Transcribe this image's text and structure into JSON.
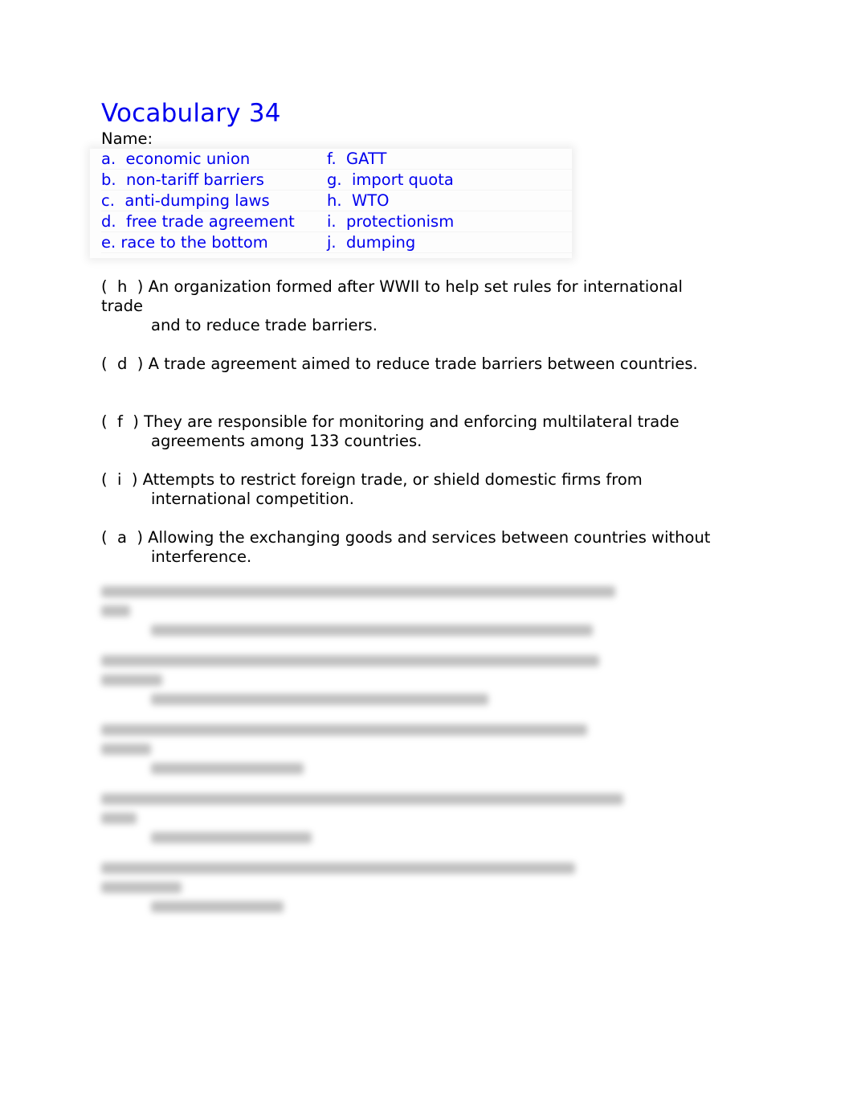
{
  "document": {
    "title": "Vocabulary 34",
    "name_label": "Name:",
    "title_color": "#0000ee"
  },
  "terms": {
    "rows": [
      {
        "left": "a.  economic union",
        "right": "f.  GATT"
      },
      {
        "left": "b.  non-tariff barriers",
        "right": "g.  import quota"
      },
      {
        "left": "c.  anti-dumping laws",
        "right": "h.  WTO"
      },
      {
        "left": "d.  free trade agreement",
        "right": "i.  protectionism"
      },
      {
        "left": "e. race to the bottom",
        "right": "j.  dumping"
      }
    ]
  },
  "questions": [
    {
      "answer_prefix": "(  h  ) ",
      "text_line1": "An organization formed after WWII to help set rules for international",
      "text_wrap": "trade",
      "text_line2": "and to reduce trade barriers."
    },
    {
      "answer_prefix": "(  d  ) ",
      "text_line1": "A trade agreement aimed to reduce trade barriers between countries.",
      "text_wrap": "",
      "text_line2": ""
    },
    {
      "answer_prefix": "(  f  ) ",
      "text_line1": "They are responsible for monitoring and enforcing multilateral trade",
      "text_wrap": "",
      "text_line2": "agreements among 133 countries."
    },
    {
      "answer_prefix": "(  i  ) ",
      "text_line1": "Attempts to restrict foreign trade, or shield domestic firms from",
      "text_wrap": "",
      "text_line2": "international competition."
    },
    {
      "answer_prefix": "(  a  ) ",
      "text_line1": "Allowing the exchanging goods and services between countries without",
      "text_wrap": "",
      "text_line2": "interference."
    }
  ],
  "obscured_section": {
    "item_count": 5,
    "note": "content blurred / not legible"
  }
}
